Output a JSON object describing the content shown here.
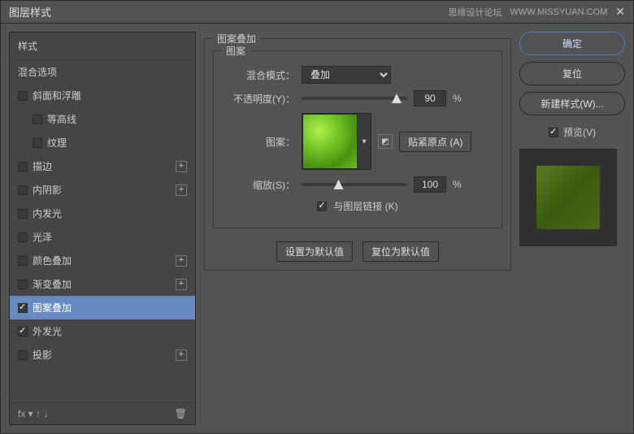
{
  "titlebar": {
    "title": "图层样式",
    "watermark": "思缘设计论坛",
    "url": "WWW.MISSYUAN.COM"
  },
  "left": {
    "header": "样式",
    "blending": "混合选项",
    "items": [
      {
        "label": "斜面和浮雕",
        "checked": false,
        "plus": false
      },
      {
        "label": "等高线",
        "checked": false,
        "indent": true
      },
      {
        "label": "纹理",
        "checked": false,
        "indent": true
      },
      {
        "label": "描边",
        "checked": false,
        "plus": true
      },
      {
        "label": "内阴影",
        "checked": false,
        "plus": true
      },
      {
        "label": "内发光",
        "checked": false,
        "plus": false
      },
      {
        "label": "光泽",
        "checked": false,
        "plus": false
      },
      {
        "label": "颜色叠加",
        "checked": false,
        "plus": true
      },
      {
        "label": "渐变叠加",
        "checked": false,
        "plus": true
      },
      {
        "label": "图案叠加",
        "checked": true,
        "selected": true
      },
      {
        "label": "外发光",
        "checked": true,
        "plus": false
      },
      {
        "label": "投影",
        "checked": false,
        "plus": true
      }
    ],
    "footer_fx": "fx"
  },
  "center": {
    "group_title": "图案叠加",
    "subgroup_title": "图案",
    "blend_mode_label": "混合模式：",
    "blend_mode_value": "叠加",
    "opacity_label": "不透明度(Y)：",
    "opacity_value": "90",
    "opacity_unit": "%",
    "pattern_label": "图案：",
    "snap_label": "贴紧原点 (A)",
    "scale_label": "缩放(S)：",
    "scale_value": "100",
    "scale_unit": "%",
    "link_label": "与图层链接 (K)",
    "link_checked": true,
    "btn_default": "设置为默认值",
    "btn_reset": "复位为默认值"
  },
  "right": {
    "ok": "确定",
    "cancel": "复位",
    "new_style": "新建样式(W)...",
    "preview_label": "预览(V)",
    "preview_checked": true
  }
}
